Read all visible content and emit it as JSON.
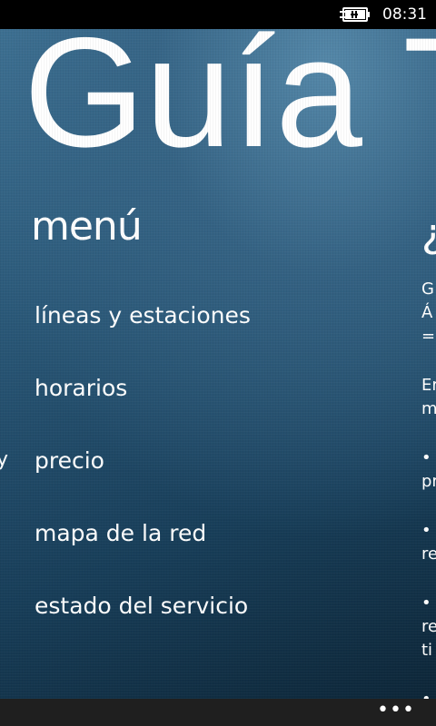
{
  "status_bar": {
    "time": "08:31",
    "battery_icon": "battery-charging-icon"
  },
  "app": {
    "title": "Guía T"
  },
  "menu": {
    "header": "menú",
    "items": [
      {
        "label": "líneas y estaciones"
      },
      {
        "label": "horarios"
      },
      {
        "label": "precio"
      },
      {
        "label": "mapa de la red"
      },
      {
        "label": "estado del servicio"
      }
    ]
  },
  "prev_peek": {
    "text": "y"
  },
  "next_peek": {
    "title": "¿",
    "lines": [
      "G",
      "Á",
      "=",
      "",
      "Er",
      "m",
      "",
      "•",
      "pr",
      "",
      "•",
      "re",
      "",
      "•",
      "re",
      "ti",
      "",
      "•"
    ]
  },
  "app_bar": {
    "more_label": "•••"
  },
  "colors": {
    "status_bar_bg": "#000000",
    "app_bar_bg": "#1f1f1f",
    "background_accent": "#2a5878",
    "text": "#ffffff"
  }
}
